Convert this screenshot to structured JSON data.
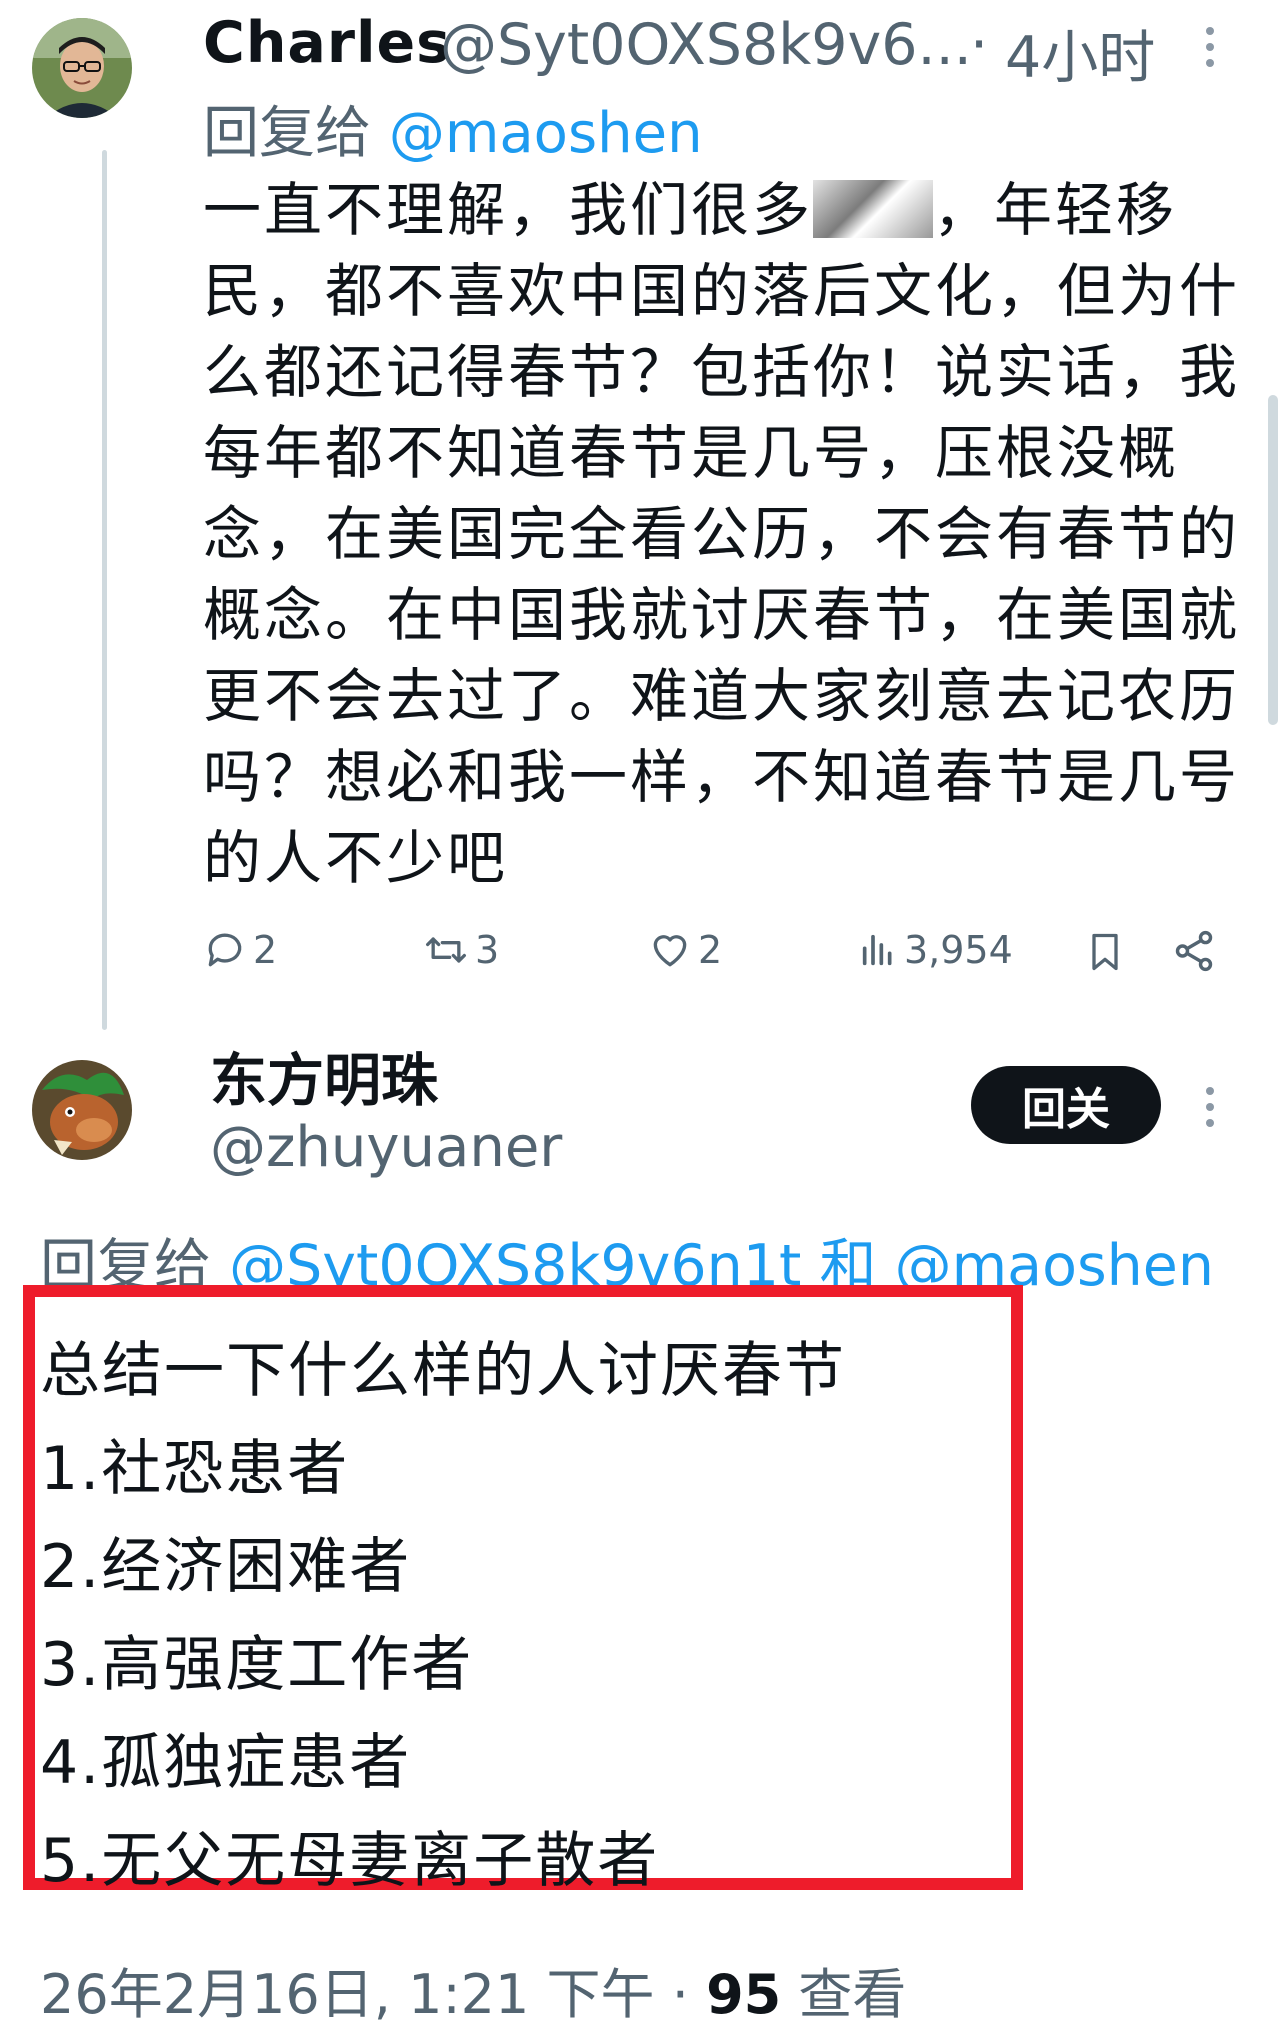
{
  "tweet1": {
    "author_name": "Charles",
    "author_handle": "@Syt0OXS8k9v6...",
    "dot": "·",
    "time": "4小时",
    "reply_prefix": "回复给",
    "reply_to": "@maoshen",
    "body_lines": [
      "一直不理解，我们很多",
      "民，都不喜欢中国的落后文化，但为什",
      "么都还记得春节？包括你！说实话，我",
      "每年都不知道春节是几号，压根没概",
      "念，在美国完全看公历，不会有春节的",
      "概念。在中国我就讨厌春节，在美国就",
      "更不会去过了。难道大家刻意去记农历",
      "吗？想必和我一样，不知道春节是几号",
      "的人不少吧"
    ],
    "body_line1_tail": "，年轻移",
    "replies": "2",
    "reposts": "3",
    "likes": "2",
    "views": "3,954",
    "icons": [
      "reply-icon",
      "repost-icon",
      "like-icon",
      "views-icon",
      "bookmark-icon",
      "share-icon",
      "more-icon"
    ]
  },
  "tweet2": {
    "author_name": "东方明珠",
    "author_handle": "@zhuyuaner",
    "follow_label": "回关",
    "reply_prefix": "回复给",
    "reply_to_1": "@Syt0OXS8k9v6n1t",
    "reply_and": "和",
    "reply_to_2": "@maoshen",
    "body_lines": [
      "总结一下什么样的人讨厌春节",
      "1.社恐患者",
      "2.经济困难者",
      "3.高强度工作者",
      "4.孤独症患者",
      "5.无父无母妻离子散者"
    ],
    "timestamp": "26年2月16日, 1:21 下午",
    "dot": "·",
    "view_count": "95",
    "view_label": "查看"
  },
  "colors": {
    "accent": "#1d9bf0",
    "secondary_text": "#536471",
    "highlight_border": "#ee1c2b"
  }
}
